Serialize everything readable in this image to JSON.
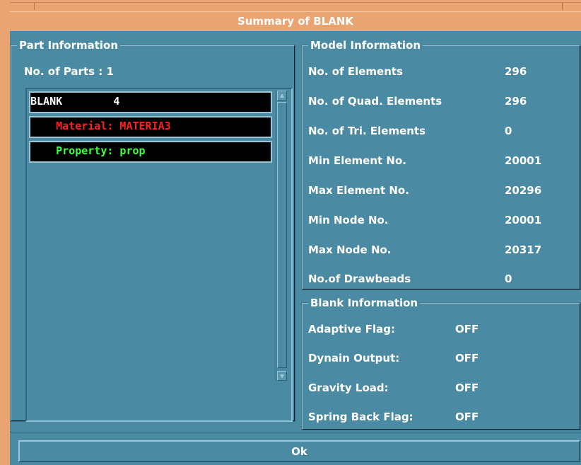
{
  "window": {
    "title": "Summary of BLANK",
    "ok_label": "Ok"
  },
  "part_info": {
    "legend": "Part Information",
    "parts_count_label": "No. of Parts :",
    "parts_count": "1",
    "parts": [
      {
        "text": "BLANK        4",
        "color": "#ffffff"
      },
      {
        "text": "    Material: MATERIA3",
        "color": "#ff2020"
      },
      {
        "text": "    Property: prop",
        "color": "#40ff40"
      }
    ]
  },
  "model_info": {
    "legend": "Model Information",
    "rows": [
      {
        "label": "No. of Elements",
        "value": "296"
      },
      {
        "label": "No. of Quad. Elements",
        "value": "296"
      },
      {
        "label": "No. of Tri. Elements",
        "value": "0"
      },
      {
        "label": "Min Element No.",
        "value": "20001"
      },
      {
        "label": "Max Element No.",
        "value": "20296"
      },
      {
        "label": "Min Node No.",
        "value": "20001"
      },
      {
        "label": "Max Node No.",
        "value": "20317"
      },
      {
        "label": "No.of Drawbeads",
        "value": "0"
      }
    ]
  },
  "blank_info": {
    "legend": "Blank Information",
    "rows": [
      {
        "label": "Adaptive Flag:",
        "value": "OFF"
      },
      {
        "label": "Dynain Output:",
        "value": "OFF"
      },
      {
        "label": "Gravity Load:",
        "value": "OFF"
      },
      {
        "label": "Spring Back Flag:",
        "value": "OFF"
      }
    ]
  },
  "colors": {
    "titlebar": "#e9a472",
    "panel": "#4a8aa3",
    "list_row_bg": "#000000"
  }
}
